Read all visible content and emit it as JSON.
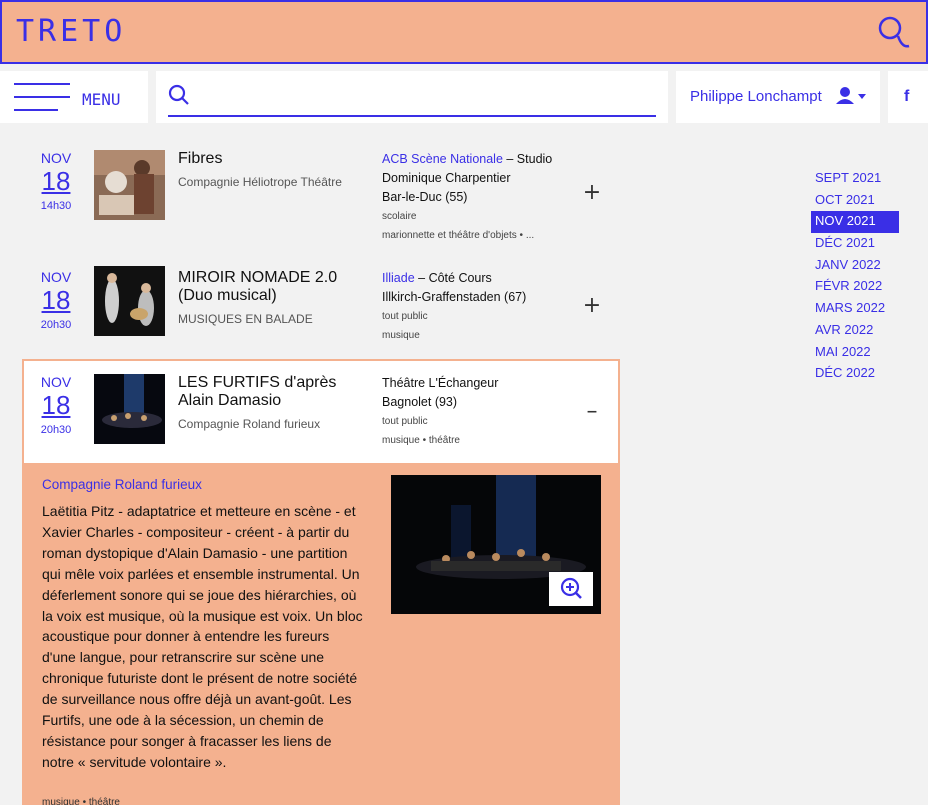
{
  "header": {
    "logo": "TRETO"
  },
  "nav": {
    "menu_label": "MENU",
    "search_placeholder": "",
    "user_name": "Philippe Lonchampt",
    "facebook": "f"
  },
  "events": [
    {
      "month": "NOV",
      "day": "18",
      "time": "14h30",
      "title": "Fibres",
      "company": "Compagnie Héliotrope Théâtre",
      "venue_link": "ACB Scène Nationale",
      "venue_rest": " – Studio Dominique Charpentier",
      "city": "Bar-le-Duc (55)",
      "audience": "scolaire",
      "tags": "marionnette et théâtre d'objets • ...",
      "toggle": "+"
    },
    {
      "month": "NOV",
      "day": "18",
      "time": "20h30",
      "title": "MIROIR NOMADE 2.0 (Duo musical)",
      "company": "MUSIQUES EN BALADE",
      "venue_link": "Illiade",
      "venue_rest": " – Côté Cours",
      "city": "Illkirch-Graffenstaden (67)",
      "audience": "tout public",
      "tags": "musique",
      "toggle": "+"
    },
    {
      "month": "NOV",
      "day": "18",
      "time": "20h30",
      "title": "LES FURTIFS d'après Alain Damasio",
      "company": "Compagnie Roland furieux",
      "venue_link": "",
      "venue_rest": "Théâtre L'Échangeur",
      "city": "Bagnolet (93)",
      "audience": "tout public",
      "tags": "musique • théâtre",
      "toggle": "–"
    }
  ],
  "detail": {
    "company": "Compagnie Roland furieux",
    "description": "Laëtitia Pitz - adaptatrice et metteure en scène - et Xavier Charles - compositeur - créent - à partir du roman dystopique d'Alain Damasio - une partition qui mêle voix parlées et ensemble instrumental. Un déferlement sonore qui se joue des hiérarchies, où la voix est musique, où la musique est voix. Un bloc acoustique pour donner à entendre les fureurs d'une langue, pour retranscrire sur scène une chronique futuriste dont le présent de notre société de surveillance nous offre déjà un avant-goût. Les Furtifs, une ode à la sécession, un chemin de résistance pour songer à fracasser les liens de notre « servitude volontaire ».",
    "tags": "musique • théâtre"
  },
  "months": [
    "SEPT 2021",
    "OCT 2021",
    "NOV 2021",
    "DÉC 2021",
    "JANV 2022",
    "FÉVR 2022",
    "MARS 2022",
    "AVR 2022",
    "MAI 2022",
    "DÉC 2022"
  ],
  "active_month": "NOV 2021",
  "colors": {
    "accent": "#3a2fe6",
    "peach": "#f4b18f"
  }
}
